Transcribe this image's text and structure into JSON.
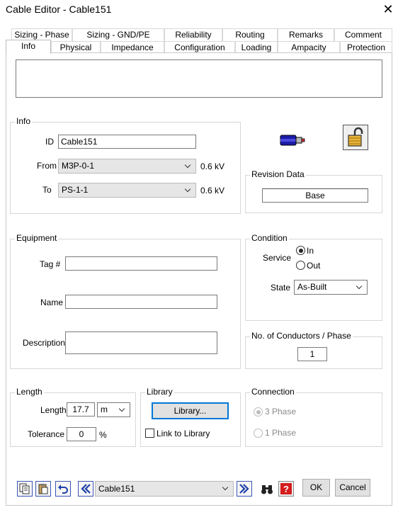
{
  "window": {
    "title": "Cable Editor - Cable151",
    "close_glyph": "✕"
  },
  "tabs_top": [
    "Sizing - Phase",
    "Sizing - GND/PE",
    "Reliability",
    "Routing",
    "Remarks",
    "Comment"
  ],
  "tabs_bottom": [
    "Info",
    "Physical",
    "Impedance",
    "Configuration",
    "Loading",
    "Ampacity",
    "Protection"
  ],
  "active_tab": "Info",
  "info": {
    "group_title": "Info",
    "id_label": "ID",
    "id_value": "Cable151",
    "from_label": "From",
    "from_value": "M3P-0-1",
    "from_kv": "0.6 kV",
    "to_label": "To",
    "to_value": "PS-1-1",
    "to_kv": "0.6 kV"
  },
  "revision": {
    "group_title": "Revision Data",
    "value": "Base"
  },
  "equipment": {
    "group_title": "Equipment",
    "tag_label": "Tag #",
    "tag_value": "",
    "name_label": "Name",
    "name_value": "",
    "description_label": "Description",
    "description_value": ""
  },
  "condition": {
    "group_title": "Condition",
    "service_label": "Service",
    "service_in": "In",
    "service_out": "Out",
    "state_label": "State",
    "state_value": "As-Built"
  },
  "conductors": {
    "group_title": "No. of Conductors / Phase",
    "value": "1"
  },
  "length": {
    "group_title": "Length",
    "length_label": "Length",
    "length_value": "17.7",
    "length_unit": "m",
    "tolerance_label": "Tolerance",
    "tolerance_value": "0",
    "tolerance_unit": "%"
  },
  "library": {
    "group_title": "Library",
    "button_label": "Library...",
    "link_label": "Link to Library"
  },
  "connection": {
    "group_title": "Connection",
    "three_phase": "3 Phase",
    "one_phase": "1 Phase"
  },
  "footer": {
    "element_value": "Cable151",
    "ok_label": "OK",
    "cancel_label": "Cancel"
  }
}
